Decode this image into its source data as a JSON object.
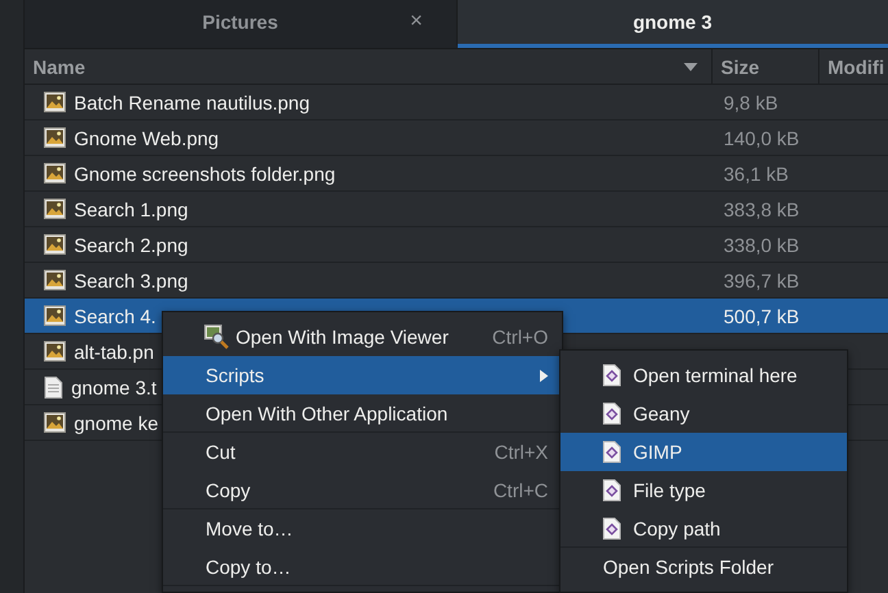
{
  "tabs": [
    {
      "label": "Pictures",
      "selected": false,
      "close": "×"
    },
    {
      "label": "gnome 3",
      "selected": true
    }
  ],
  "columns": [
    {
      "label": "Name",
      "sorted": true
    },
    {
      "label": "Size",
      "sorted": false
    },
    {
      "label": "Modifi"
    }
  ],
  "rows": [
    {
      "name": "Batch Rename nautilus.png",
      "size": "9,8 kB",
      "kind": "image",
      "selected": false
    },
    {
      "name": "Gnome Web.png",
      "size": "140,0 kB",
      "kind": "image",
      "selected": false
    },
    {
      "name": "Gnome screenshots folder.png",
      "size": "36,1 kB",
      "kind": "image",
      "selected": false
    },
    {
      "name": "Search 1.png",
      "size": "383,8 kB",
      "kind": "image",
      "selected": false
    },
    {
      "name": "Search 2.png",
      "size": "338,0 kB",
      "kind": "image",
      "selected": false
    },
    {
      "name": "Search 3.png",
      "size": "396,7 kB",
      "kind": "image",
      "selected": false
    },
    {
      "name": "Search 4.",
      "size": "500,7 kB",
      "kind": "image",
      "selected": true
    },
    {
      "name": "alt-tab.pn",
      "kind": "image",
      "selected": false
    },
    {
      "name": "gnome 3.t",
      "kind": "text",
      "selected": false
    },
    {
      "name": "gnome ke",
      "kind": "image",
      "selected": false
    }
  ],
  "context_menu": {
    "items": [
      {
        "label": "Open With Image Viewer",
        "shortcut": "Ctrl+O",
        "kind": "viewer",
        "submenu": false,
        "selected": false,
        "separator_after": false
      },
      {
        "label": "Scripts",
        "kind": "plain",
        "submenu": true,
        "selected": true,
        "separator_after": false
      },
      {
        "label": "Open With Other Application",
        "kind": "plain",
        "submenu": false,
        "selected": false,
        "separator_after": true
      },
      {
        "label": "Cut",
        "shortcut": "Ctrl+X",
        "kind": "plain",
        "submenu": false,
        "selected": false,
        "separator_after": false
      },
      {
        "label": "Copy",
        "shortcut": "Ctrl+C",
        "kind": "plain",
        "submenu": false,
        "selected": false,
        "separator_after": true
      },
      {
        "label": "Move to…",
        "kind": "plain",
        "submenu": false,
        "selected": false,
        "separator_after": false
      },
      {
        "label": "Copy to…",
        "kind": "plain",
        "submenu": false,
        "selected": false,
        "separator_after": true
      }
    ]
  },
  "scripts_menu": {
    "items": [
      {
        "label": "Open terminal here",
        "kind": "script",
        "selected": false,
        "separator_after": false
      },
      {
        "label": "Geany",
        "kind": "script",
        "selected": false,
        "separator_after": false
      },
      {
        "label": "GIMP",
        "kind": "script",
        "selected": true,
        "separator_after": false
      },
      {
        "label": "File type",
        "kind": "script",
        "selected": false,
        "separator_after": false
      },
      {
        "label": "Copy path",
        "kind": "script",
        "selected": false,
        "separator_after": true
      },
      {
        "label": "Open Scripts Folder",
        "kind": "action",
        "selected": false,
        "separator_after": false
      }
    ]
  }
}
